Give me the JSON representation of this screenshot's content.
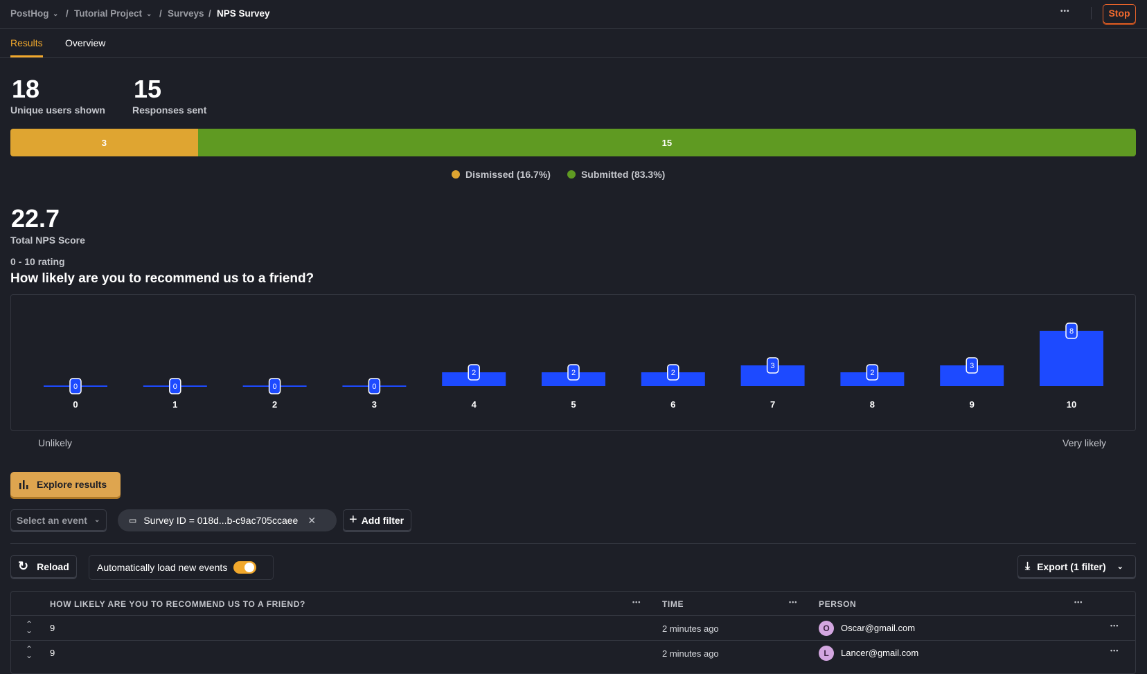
{
  "breadcrumb": {
    "org": "PostHog",
    "project": "Tutorial Project",
    "section": "Surveys",
    "current": "NPS Survey"
  },
  "header": {
    "more": "•••",
    "stop_label": "Stop"
  },
  "tabs": [
    {
      "label": "Results",
      "active": true
    },
    {
      "label": "Overview",
      "active": false
    }
  ],
  "stats": {
    "shown_value": "18",
    "shown_label": "Unique users shown",
    "sent_value": "15",
    "sent_label": "Responses sent"
  },
  "progress": {
    "dismissed": 3,
    "submitted": 15,
    "dismissed_label": "3",
    "submitted_label": "15",
    "legend_dismissed": "Dismissed (16.7%)",
    "legend_submitted": "Submitted (83.3%)",
    "colors": {
      "dismissed": "#dfa531",
      "submitted": "#5f9a22"
    }
  },
  "nps": {
    "score": "22.7",
    "label": "Total NPS Score"
  },
  "question": {
    "type_label": "0 - 10 rating",
    "text": "How likely are you to recommend us to a friend?",
    "low_label": "Unlikely",
    "high_label": "Very likely"
  },
  "chart_data": {
    "type": "bar",
    "categories": [
      "0",
      "1",
      "2",
      "3",
      "4",
      "5",
      "6",
      "7",
      "8",
      "9",
      "10"
    ],
    "values": [
      0,
      0,
      0,
      0,
      2,
      2,
      2,
      3,
      2,
      3,
      8
    ],
    "color": "#1d4aff",
    "ylim": [
      0,
      8
    ]
  },
  "actions": {
    "explore": "Explore results",
    "select_event": "Select an event",
    "filter_chip": "Survey ID = 018d...b-c9ac705ccaee",
    "add_filter": "Add filter",
    "reload": "Reload",
    "auto_load": "Automatically load new events",
    "export": "Export (1 filter)"
  },
  "table": {
    "columns": [
      "HOW LIKELY ARE YOU TO RECOMMEND US TO A FRIEND?",
      "TIME",
      "PERSON"
    ],
    "more": "•••",
    "rows": [
      {
        "answer": "9",
        "time": "2 minutes ago",
        "initial": "O",
        "person": "Oscar@gmail.com"
      },
      {
        "answer": "9",
        "time": "2 minutes ago",
        "initial": "L",
        "person": "Lancer@gmail.com"
      }
    ]
  }
}
